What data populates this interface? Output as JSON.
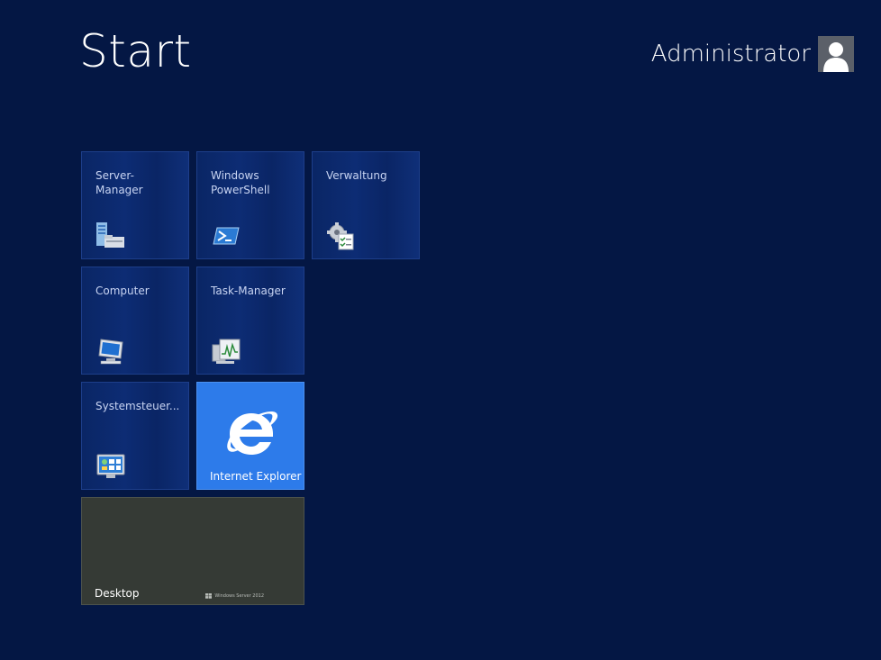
{
  "header": {
    "title": "Start",
    "user_name": "Administrator"
  },
  "tiles": [
    {
      "label": "Server-\nManager",
      "icon": "server-manager-icon"
    },
    {
      "label": "Windows\nPowerShell",
      "icon": "powershell-icon"
    },
    {
      "label": "Verwaltung",
      "icon": "administrative-tools-icon"
    },
    {
      "label": "Computer",
      "icon": "computer-icon"
    },
    {
      "label": "Task-Manager",
      "icon": "task-manager-icon"
    },
    {
      "label": "Systemsteuer...",
      "icon": "control-panel-icon"
    },
    {
      "label": "Internet Explorer",
      "icon": "internet-explorer-icon"
    },
    {
      "label": "Desktop",
      "brand": "Windows Server 2012"
    }
  ],
  "colors": {
    "background": "#041744",
    "tile_blue": "#0a2665",
    "ie_tile": "#2d7bea",
    "desktop_tile": "#353a35"
  }
}
